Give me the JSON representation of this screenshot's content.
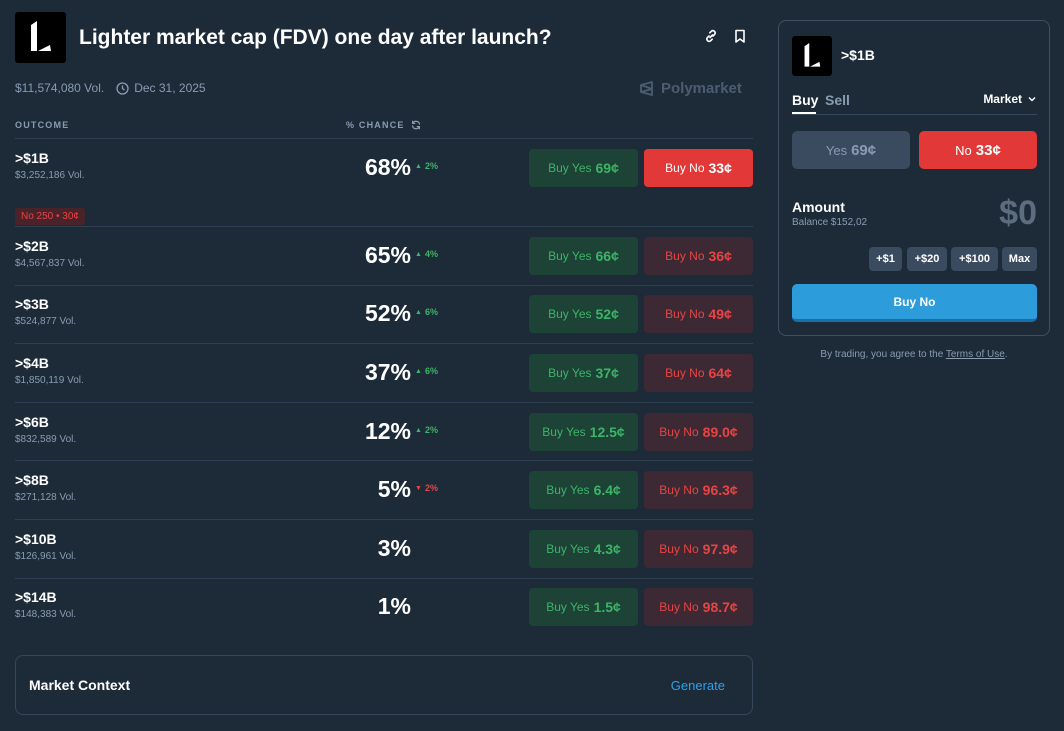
{
  "header": {
    "title": "Lighter market cap (FDV) one day after launch?",
    "volume": "$11,574,080 Vol.",
    "date": "Dec 31, 2025",
    "source": "Polymarket",
    "link_icon": "link-icon",
    "bookmark_icon": "bookmark-icon"
  },
  "table": {
    "col_outcome": "OUTCOME",
    "col_chance": "% CHANCE",
    "rows": [
      {
        "name": ">$1B",
        "vol": "$3,252,186 Vol.",
        "pill": "No 250 • 30¢",
        "pct": "68%",
        "delta": "2%",
        "dir": "up",
        "yes_label": "Buy Yes",
        "yes_price": "69¢",
        "no_label": "Buy No",
        "no_price": "33¢"
      },
      {
        "name": ">$2B",
        "vol": "$4,567,837 Vol.",
        "pct": "65%",
        "delta": "4%",
        "dir": "up",
        "yes_label": "Buy Yes",
        "yes_price": "66¢",
        "no_label": "Buy No",
        "no_price": "36¢"
      },
      {
        "name": ">$3B",
        "vol": "$524,877 Vol.",
        "pct": "52%",
        "delta": "6%",
        "dir": "up",
        "yes_label": "Buy Yes",
        "yes_price": "52¢",
        "no_label": "Buy No",
        "no_price": "49¢"
      },
      {
        "name": ">$4B",
        "vol": "$1,850,119 Vol.",
        "pct": "37%",
        "delta": "6%",
        "dir": "up",
        "yes_label": "Buy Yes",
        "yes_price": "37¢",
        "no_label": "Buy No",
        "no_price": "64¢"
      },
      {
        "name": ">$6B",
        "vol": "$832,589 Vol.",
        "pct": "12%",
        "delta": "2%",
        "dir": "up",
        "yes_label": "Buy Yes",
        "yes_price": "12.5¢",
        "no_label": "Buy No",
        "no_price": "89.0¢"
      },
      {
        "name": ">$8B",
        "vol": "$271,128 Vol.",
        "pct": "5%",
        "delta": "2%",
        "dir": "down",
        "yes_label": "Buy Yes",
        "yes_price": "6.4¢",
        "no_label": "Buy No",
        "no_price": "96.3¢"
      },
      {
        "name": ">$10B",
        "vol": "$126,961 Vol.",
        "pct": "3%",
        "delta": "",
        "dir": "",
        "yes_label": "Buy Yes",
        "yes_price": "4.3¢",
        "no_label": "Buy No",
        "no_price": "97.9¢"
      },
      {
        "name": ">$14B",
        "vol": "$148,383 Vol.",
        "pct": "1%",
        "delta": "",
        "dir": "",
        "yes_label": "Buy Yes",
        "yes_price": "1.5¢",
        "no_label": "Buy No",
        "no_price": "98.7¢"
      }
    ]
  },
  "context": {
    "title": "Market Context",
    "action": "Generate"
  },
  "panel": {
    "title": ">$1B",
    "tab_buy": "Buy",
    "tab_sell": "Sell",
    "order_type": "Market",
    "yes_label": "Yes",
    "yes_price": "69¢",
    "no_label": "No",
    "no_price": "33¢",
    "amount_label": "Amount",
    "balance": "Balance $152,02",
    "amount_value": "$0",
    "chips": [
      "+$1",
      "+$20",
      "+$100",
      "Max"
    ],
    "buy_button": "Buy No"
  },
  "terms": {
    "prefix": "By trading, you agree to the ",
    "link": "Terms of Use",
    "suffix": "."
  },
  "colors": {
    "background": "#1d2b39",
    "yes_green": "#3db468",
    "no_red": "#e64545",
    "accent_blue": "#2d9cdb"
  }
}
